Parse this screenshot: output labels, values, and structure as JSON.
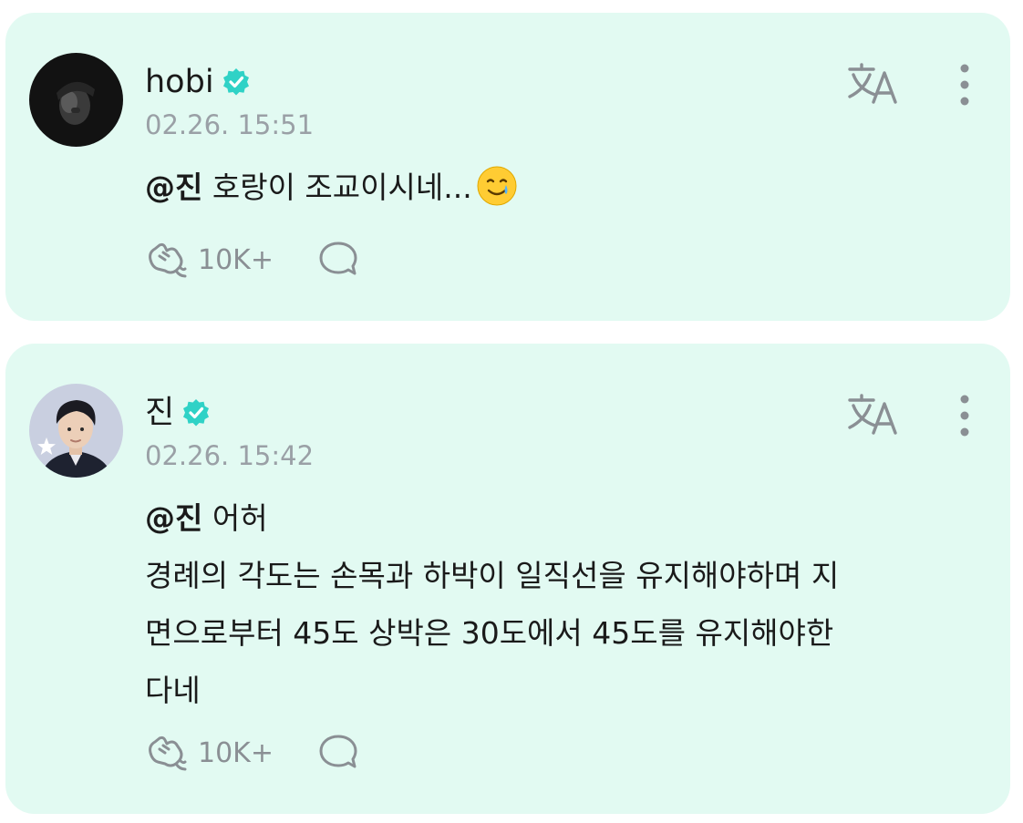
{
  "posts": [
    {
      "author": "hobi",
      "timestamp": "02.26. 15:51",
      "mention": "@진",
      "body_lines": [
        " 호랑이 조교이시네..."
      ],
      "cheer_count": "10K+",
      "verified": true,
      "emoji": "smiling-face-with-tear"
    },
    {
      "author": "진",
      "timestamp": "02.26. 15:42",
      "mention": "@진",
      "body_lines": [
        " 어허",
        "경례의 각도는 손목과 하박이 일직선을 유지해야하며 지",
        "면으로부터 45도 상박은 30도에서 45도를 유지해야한",
        "다네"
      ],
      "cheer_count": "10K+",
      "verified": true
    }
  ],
  "colors": {
    "card_background": "#e2faf2",
    "verified_badge": "#2fd2c6",
    "muted_text": "#9aa0a6",
    "icon_gray": "#8a8f94"
  },
  "icons": {
    "translate": "translate-icon",
    "more": "more-vertical-icon",
    "cheer": "cheer-hand-icon",
    "comment": "comment-bubble-icon",
    "verified": "verified-badge-icon"
  }
}
